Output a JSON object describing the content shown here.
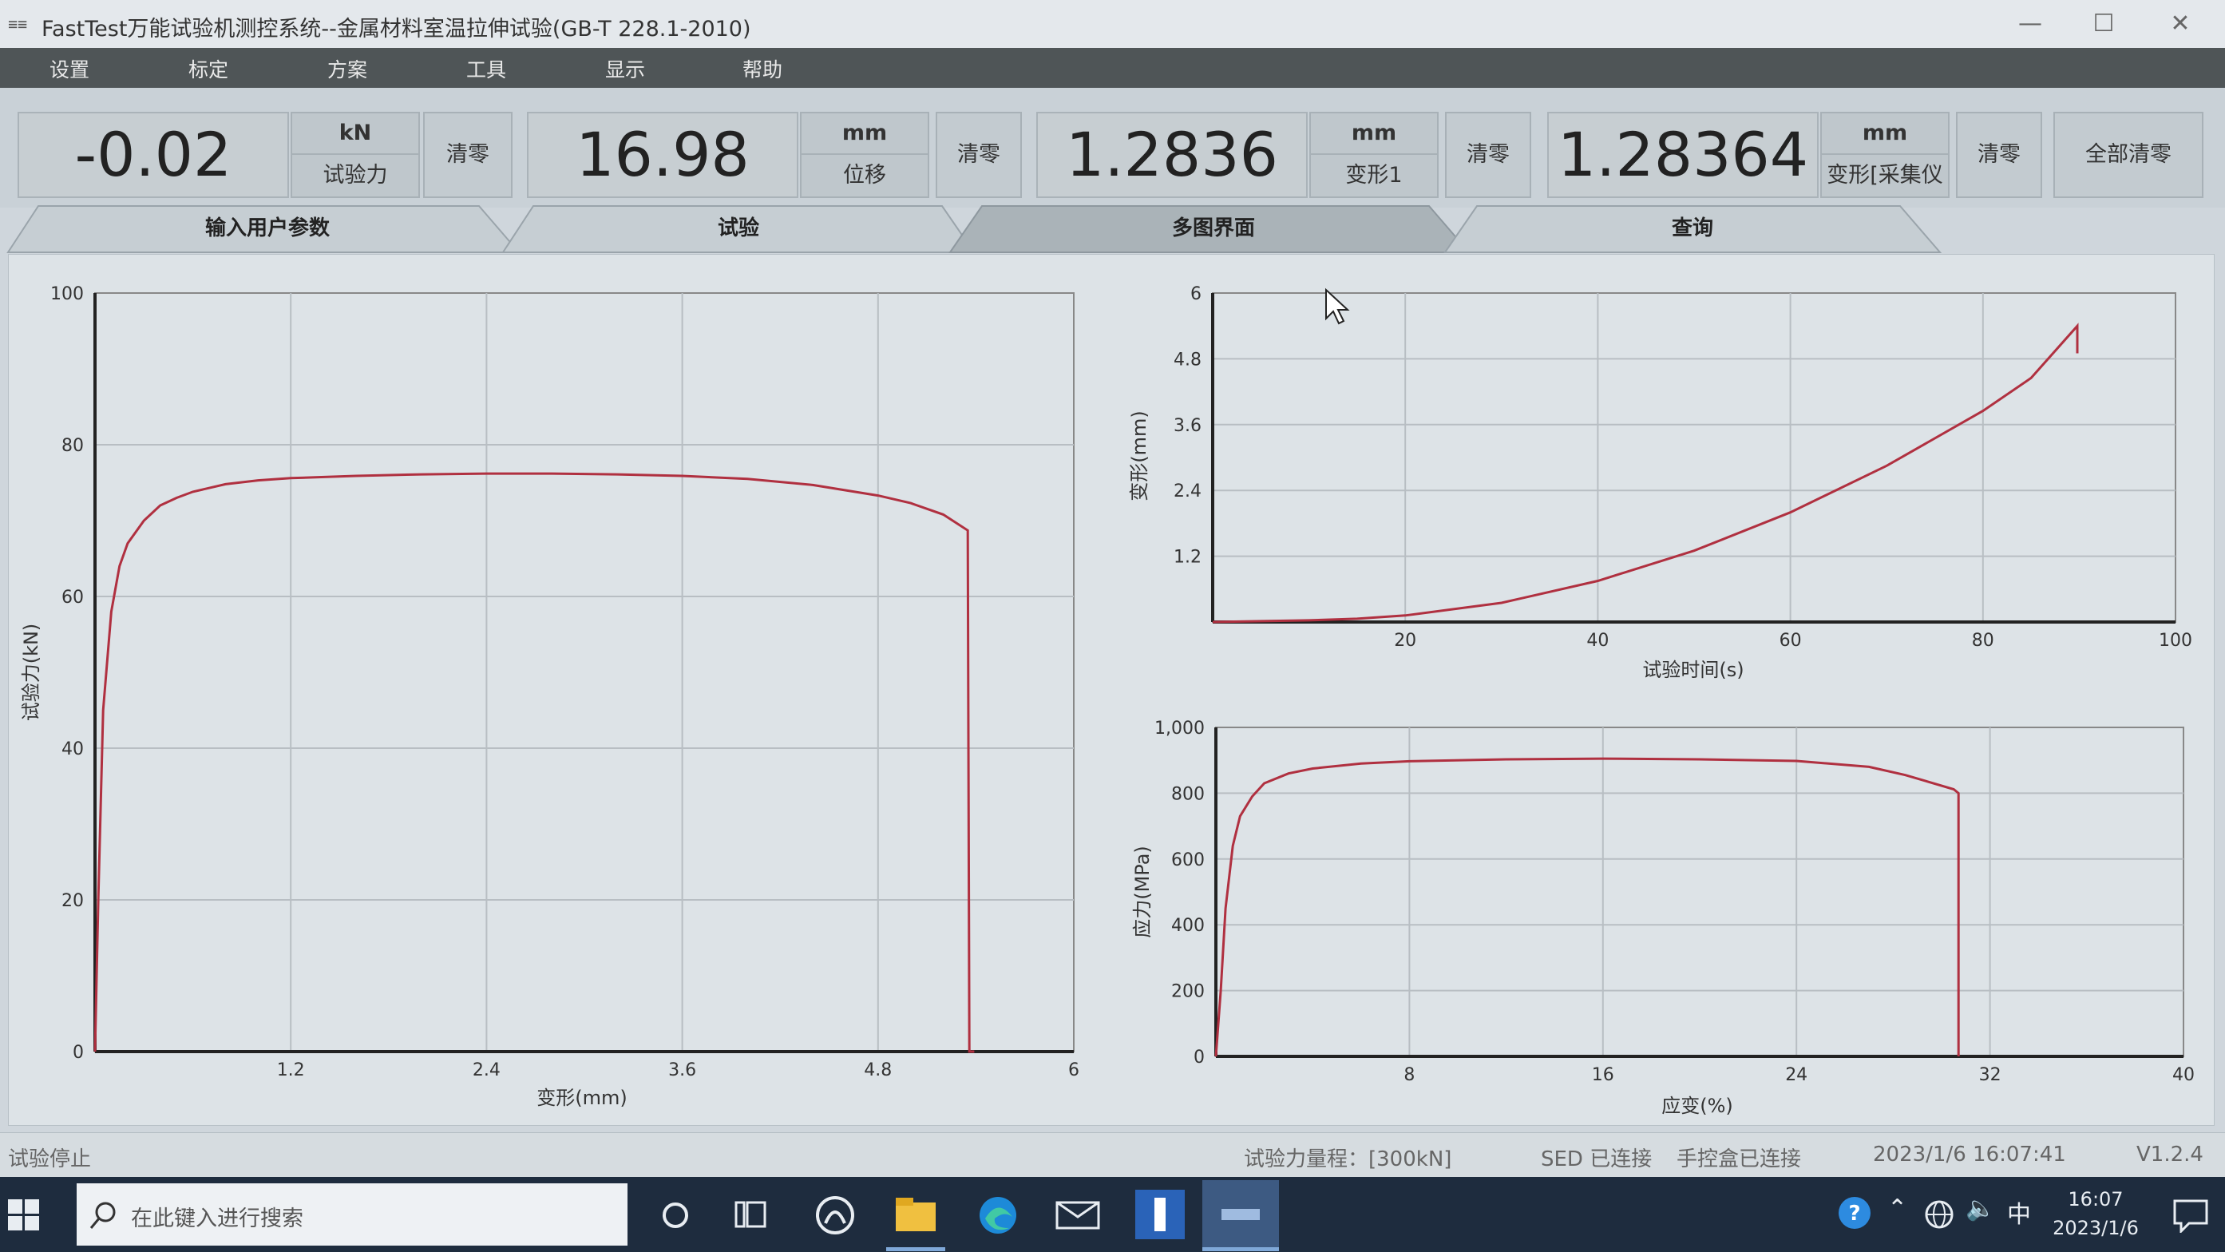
{
  "window": {
    "title": "FastTest万能试验机测控系统--金属材料室温拉伸试验(GB-T 228.1-2010)",
    "app_icon": "≡≡",
    "minimize_glyph": "—",
    "maximize_glyph": "☐",
    "close_glyph": "✕"
  },
  "menu": [
    "设置",
    "标定",
    "方案",
    "工具",
    "显示",
    "帮助"
  ],
  "readouts": [
    {
      "value": "-0.02",
      "unit": "kN",
      "name": "试验力",
      "zero": "清零"
    },
    {
      "value": "16.98",
      "unit": "mm",
      "name": "位移",
      "zero": "清零"
    },
    {
      "value": "1.2836",
      "unit": "mm",
      "name": "变形1",
      "zero": "清零"
    },
    {
      "value": "1.28364",
      "unit": "mm",
      "name": "变形[采集仪",
      "zero": "清零"
    }
  ],
  "zero_all": "全部清零",
  "tabs": [
    "输入用户参数",
    "试验",
    "多图界面",
    "查询"
  ],
  "active_tab": 2,
  "colors": {
    "curve": "#b03040",
    "grid": "#b8bec3",
    "plot_bg": "#dde3e7"
  },
  "chart_data": [
    {
      "type": "line",
      "xlabel": "变形(mm)",
      "ylabel": "试验力(kN)",
      "xlim": [
        0,
        6
      ],
      "ylim": [
        0,
        100
      ],
      "xticks": [
        "1.2",
        "2.4",
        "3.6",
        "4.8",
        "6"
      ],
      "yticks": [
        "0",
        "20",
        "40",
        "60",
        "80",
        "100"
      ],
      "x": [
        0,
        0.02,
        0.05,
        0.1,
        0.15,
        0.2,
        0.3,
        0.4,
        0.5,
        0.6,
        0.8,
        1.0,
        1.2,
        1.6,
        2.0,
        2.4,
        2.8,
        3.2,
        3.6,
        4.0,
        4.4,
        4.8,
        5.0,
        5.2,
        5.35,
        5.36,
        5.39
      ],
      "y": [
        0,
        20,
        45,
        58,
        64,
        67,
        70,
        72,
        73,
        73.8,
        74.8,
        75.3,
        75.6,
        75.9,
        76.1,
        76.2,
        76.2,
        76.1,
        75.9,
        75.5,
        74.7,
        73.3,
        72.3,
        70.8,
        68.7,
        0,
        0
      ]
    },
    {
      "type": "line",
      "xlabel": "试验时间(s)",
      "ylabel": "变形(mm)",
      "xlim": [
        0,
        100
      ],
      "ylim": [
        0,
        6
      ],
      "xticks": [
        "20",
        "40",
        "60",
        "80",
        "100"
      ],
      "yticks": [
        "1.2",
        "2.4",
        "3.6",
        "4.8",
        "6"
      ],
      "x": [
        0,
        10,
        15,
        20,
        30,
        40,
        50,
        60,
        70,
        80,
        85,
        89.8,
        89.8
      ],
      "y": [
        0,
        0.03,
        0.06,
        0.12,
        0.35,
        0.75,
        1.3,
        2.0,
        2.85,
        3.85,
        4.45,
        5.4,
        4.9
      ]
    },
    {
      "type": "line",
      "xlabel": "应变(%)",
      "ylabel": "应力(MPa)",
      "xlim": [
        0,
        40
      ],
      "ylim": [
        0,
        1000
      ],
      "xticks": [
        "8",
        "16",
        "24",
        "32",
        "40"
      ],
      "yticks": [
        "0",
        "200",
        "400",
        "600",
        "800",
        "1,000"
      ],
      "x": [
        0,
        0.2,
        0.4,
        0.7,
        1.0,
        1.5,
        2,
        3,
        4,
        6,
        8,
        12,
        16,
        20,
        24,
        27,
        28.5,
        30.5,
        30.7,
        30.7
      ],
      "y": [
        0,
        200,
        450,
        640,
        730,
        790,
        830,
        860,
        875,
        890,
        897,
        903,
        905,
        903,
        898,
        880,
        855,
        812,
        800,
        0
      ]
    }
  ],
  "status": {
    "left": "试验停止",
    "range": "试验力量程：[300kN]",
    "sed": "SED 已连接",
    "handbox": "手控盒已连接",
    "datetime": "2023/1/6 16:07:41",
    "version": "V1.2.4"
  },
  "taskbar": {
    "search_placeholder": "在此键入进行搜索",
    "ime": "中",
    "time": "16:07",
    "date": "2023/1/6",
    "icons": [
      "windows-start-icon",
      "search-icon",
      "cortana-icon",
      "task-view-icon",
      "app-circle-icon",
      "file-explorer-icon",
      "edge-icon",
      "mail-icon",
      "testing-app-icon",
      "active-window-icon"
    ]
  }
}
